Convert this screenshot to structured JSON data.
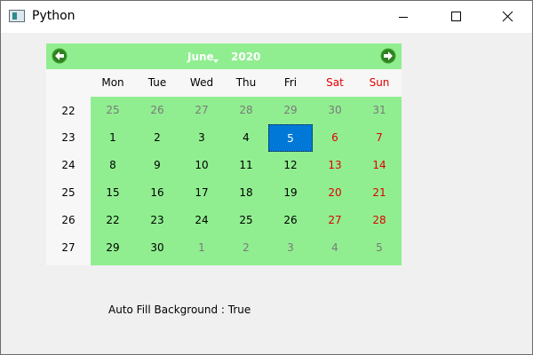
{
  "window": {
    "title": "Python"
  },
  "calendar": {
    "month": "June",
    "year": "2020",
    "day_headers": [
      {
        "label": "Mon",
        "weekend": false
      },
      {
        "label": "Tue",
        "weekend": false
      },
      {
        "label": "Wed",
        "weekend": false
      },
      {
        "label": "Thu",
        "weekend": false
      },
      {
        "label": "Fri",
        "weekend": false
      },
      {
        "label": "Sat",
        "weekend": true
      },
      {
        "label": "Sun",
        "weekend": true
      }
    ],
    "weeks": [
      {
        "number": "22",
        "days": [
          {
            "d": "25",
            "other": true
          },
          {
            "d": "26",
            "other": true
          },
          {
            "d": "27",
            "other": true
          },
          {
            "d": "28",
            "other": true
          },
          {
            "d": "29",
            "other": true
          },
          {
            "d": "30",
            "other": true
          },
          {
            "d": "31",
            "other": true
          }
        ]
      },
      {
        "number": "23",
        "days": [
          {
            "d": "1"
          },
          {
            "d": "2"
          },
          {
            "d": "3"
          },
          {
            "d": "4"
          },
          {
            "d": "5",
            "selected": true
          },
          {
            "d": "6",
            "weekend": true
          },
          {
            "d": "7",
            "weekend": true
          }
        ]
      },
      {
        "number": "24",
        "days": [
          {
            "d": "8"
          },
          {
            "d": "9"
          },
          {
            "d": "10"
          },
          {
            "d": "11"
          },
          {
            "d": "12"
          },
          {
            "d": "13",
            "weekend": true
          },
          {
            "d": "14",
            "weekend": true
          }
        ]
      },
      {
        "number": "25",
        "days": [
          {
            "d": "15"
          },
          {
            "d": "16"
          },
          {
            "d": "17"
          },
          {
            "d": "18"
          },
          {
            "d": "19"
          },
          {
            "d": "20",
            "weekend": true
          },
          {
            "d": "21",
            "weekend": true
          }
        ]
      },
      {
        "number": "26",
        "days": [
          {
            "d": "22"
          },
          {
            "d": "23"
          },
          {
            "d": "24"
          },
          {
            "d": "25"
          },
          {
            "d": "26"
          },
          {
            "d": "27",
            "weekend": true
          },
          {
            "d": "28",
            "weekend": true
          }
        ]
      },
      {
        "number": "27",
        "days": [
          {
            "d": "29"
          },
          {
            "d": "30"
          },
          {
            "d": "1",
            "other": true
          },
          {
            "d": "2",
            "other": true
          },
          {
            "d": "3",
            "other": true
          },
          {
            "d": "4",
            "other": true
          },
          {
            "d": "5",
            "other": true
          }
        ]
      }
    ]
  },
  "label": {
    "text": "Auto Fill Background : True"
  },
  "colors": {
    "calendar_background": "#90ee90",
    "weekend_text": "#e00000",
    "other_month_text": "#7a7a7a",
    "selection": "#0078d7",
    "nav_arrow": "#3a9a2a"
  },
  "icons": {
    "prev": "left-arrow-circle-icon",
    "next": "right-arrow-circle-icon",
    "minimize": "minimize-icon",
    "maximize": "maximize-icon",
    "close": "close-icon",
    "app": "python-window-icon"
  }
}
